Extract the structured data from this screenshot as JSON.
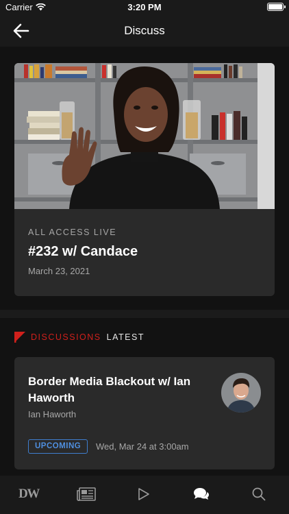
{
  "status_bar": {
    "carrier": "Carrier",
    "time": "3:20 PM"
  },
  "nav": {
    "title": "Discuss"
  },
  "feature": {
    "eyebrow": "ALL ACCESS LIVE",
    "title": "#232 w/ Candace",
    "date": "March 23, 2021"
  },
  "section": {
    "label": "DISCUSSIONS",
    "sublabel": "LATEST",
    "accent": "#d0201c"
  },
  "discussion": {
    "title": "Border Media Blackout w/ Ian Haworth",
    "author": "Ian Haworth",
    "badge": "UPCOMING",
    "datetime": "Wed, Mar 24 at 3:00am"
  },
  "tabs": [
    {
      "name": "home",
      "label": "DW",
      "icon": "dw-logo-icon"
    },
    {
      "name": "news",
      "icon": "newspaper-icon"
    },
    {
      "name": "watch",
      "icon": "play-icon"
    },
    {
      "name": "discuss",
      "icon": "chat-bubbles-icon",
      "active": true
    },
    {
      "name": "search",
      "icon": "search-icon"
    }
  ]
}
